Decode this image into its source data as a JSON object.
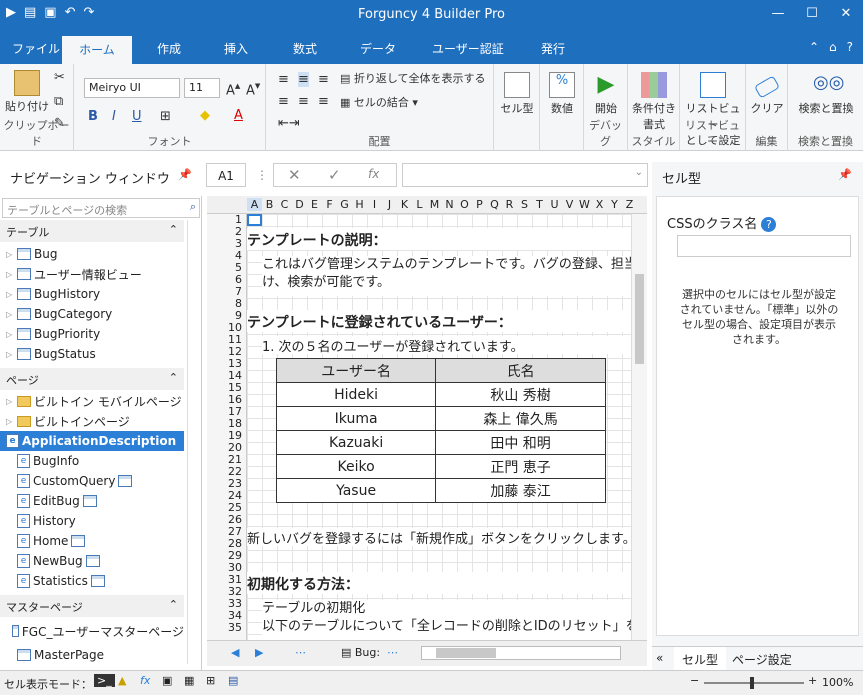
{
  "title": "Forguncy 4 Builder Pro",
  "tabs": [
    "ファイル",
    "ホーム",
    "作成",
    "挿入",
    "数式",
    "データ",
    "ユーザー認証",
    "発行"
  ],
  "ribbon": {
    "paste": "貼り付け",
    "clipboard": "クリップボード",
    "font_name": "Meiryo UI",
    "font_size": "11",
    "font": "フォント",
    "wrap": "折り返して全体を表示する",
    "merge": "セルの結合",
    "align": "配置",
    "celltype": "セル型",
    "number": "数値",
    "start": "開始",
    "debug": "デバッグ",
    "cond1": "条件付き",
    "cond2": "書式",
    "style": "スタイル",
    "list1": "リストビュー",
    "list2": "として設定",
    "listview": "リストビュー",
    "clear": "クリア",
    "edit": "編集",
    "find": "検索と置換",
    "find_group": "検索と置換"
  },
  "formula": {
    "cell_ref": "A1"
  },
  "nav": {
    "title": "ナビゲーション ウィンドウ",
    "search": "テーブルとページの検索",
    "sec_table": "テーブル",
    "tables": [
      "Bug",
      "ユーザー情報ビュー",
      "BugHistory",
      "BugCategory",
      "BugPriority",
      "BugStatus"
    ],
    "sec_page": "ページ",
    "folders": [
      "ビルトイン モバイルページ",
      "ビルトインページ"
    ],
    "pages": [
      "ApplicationDescription",
      "BugInfo",
      "CustomQuery",
      "EditBug",
      "History",
      "Home",
      "NewBug",
      "Statistics"
    ],
    "sec_master": "マスターページ",
    "masters": [
      "FGC_ユーザーマスターページ",
      "MasterPage"
    ]
  },
  "sheet": {
    "cols": [
      "A",
      "B",
      "C",
      "D",
      "E",
      "F",
      "G",
      "H",
      "I",
      "J",
      "K",
      "L",
      "M",
      "N",
      "O",
      "P",
      "Q",
      "R",
      "S",
      "T",
      "U",
      "V",
      "W",
      "X",
      "Y",
      "Z"
    ],
    "rows": [
      "1",
      "2",
      "3",
      "4",
      "5",
      "6",
      "7",
      "8",
      "9",
      "10",
      "11",
      "12",
      "13",
      "14",
      "15",
      "16",
      "17",
      "18",
      "19",
      "20",
      "21",
      "22",
      "23",
      "24",
      "25",
      "26",
      "27",
      "28",
      "29",
      "30",
      "31",
      "32",
      "33",
      "34",
      "35"
    ],
    "h1": "テンプレートの説明：",
    "p1a": "これはバグ管理システムのテンプレートです。バグの登録、担当者",
    "p1b": "け、検索が可能です。",
    "h2": "テンプレートに登録されているユーザー：",
    "l1": "1. 次の５名のユーザーが登録されています。",
    "th": [
      "ユーザー名",
      "氏名"
    ],
    "users": [
      [
        "Hideki",
        "秋山 秀樹"
      ],
      [
        "Ikuma",
        "森上 偉久馬"
      ],
      [
        "Kazuaki",
        "田中 和明"
      ],
      [
        "Keiko",
        "正門 恵子"
      ],
      [
        "Yasue",
        "加藤 泰江"
      ]
    ],
    "p2": "新しいバグを登録するには「新規作成」ボタンをクリックします。",
    "h3": "初期化する方法：",
    "p3a": "テーブルの初期化",
    "p3b": "以下のテーブルについて「全レコードの削除とIDのリセット」を行う",
    "sheet_tab": "Bug:"
  },
  "right": {
    "title": "セル型",
    "css": "CSSのクラス名",
    "msg": "選択中のセルにはセル型が設定されていません。「標準」以外のセル型の場合、設定項目が表示されます。",
    "tab1": "セル型",
    "tab2": "ページ設定"
  },
  "status": {
    "mode": "セル表示モード：",
    "zoom": "100%"
  }
}
